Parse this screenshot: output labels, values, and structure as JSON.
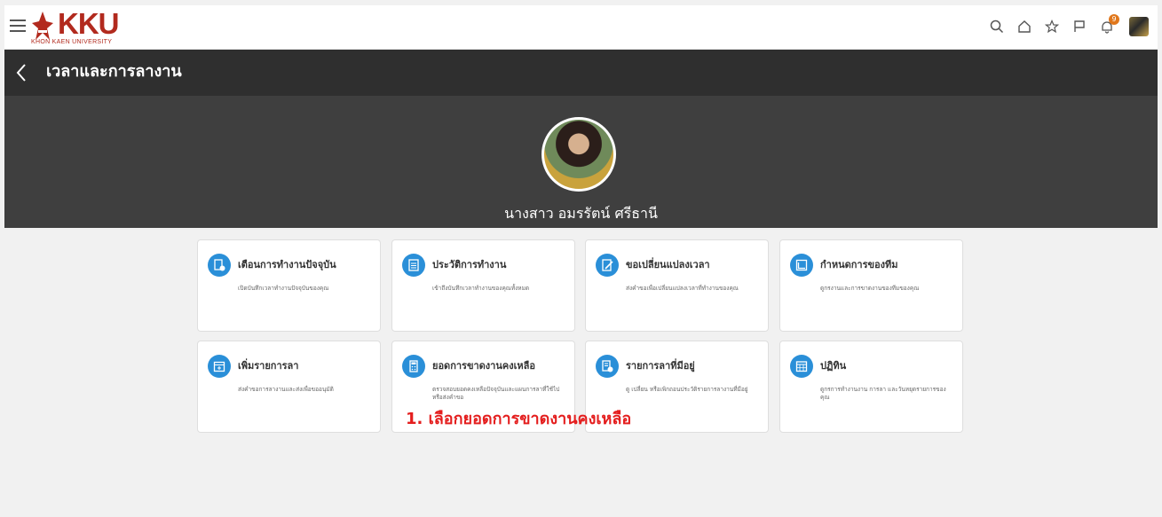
{
  "header": {
    "logo_text": "KKU",
    "logo_subtitle": "KHON KAEN UNIVERSITY",
    "notification_count": "9",
    "icons": [
      "menu-icon",
      "search-icon",
      "home-icon",
      "star-icon",
      "flag-icon",
      "bell-icon"
    ]
  },
  "titlebar": {
    "title": "เวลาและการลางาน"
  },
  "profile": {
    "name": "นางสาว อมรรัตน์ ศรีธานี"
  },
  "cards": [
    {
      "title": "เตือนการทำงานปัจจุบัน",
      "desc": "เปิดบันทึกเวลาทำงานปัจจุบันของคุณ",
      "icon": "document-clock-icon"
    },
    {
      "title": "ประวัติการทำงาน",
      "desc": "เข้าถึงบันทึกเวลาทำงานของคุณทั้งหมด",
      "icon": "document-list-icon"
    },
    {
      "title": "ขอเปลี่ยนแปลงเวลา",
      "desc": "ส่งคำขอเพื่อเปลี่ยนแปลงเวลาที่ทำงานของคุณ",
      "icon": "edit-document-icon"
    },
    {
      "title": "กำหนดการของทีม",
      "desc": "ดูกรงานและการขาดงานของทีมของคุณ",
      "icon": "chart-icon"
    },
    {
      "title": "เพิ่มรายการลา",
      "desc": "ส่งคำขอการลางานและส่งเพื่อขออนุมัติ",
      "icon": "calendar-add-icon"
    },
    {
      "title": "ยอดการขาดงานคงเหลือ",
      "desc": "ตรวจสอบยอดคงเหลือปัจจุบันและแผนการลาที่ใช้ไปหรือส่งคำขอ",
      "icon": "calculator-icon"
    },
    {
      "title": "รายการลาที่มีอยู่",
      "desc": "ดู เปลี่ยน หรือเพิกถอนประวัติรายการลางานที่มีอยู่",
      "icon": "list-clock-icon"
    },
    {
      "title": "ปฏิทิน",
      "desc": "ดูกรการทำงานงาน การลา และวันหยุดรายการของคุณ",
      "icon": "calendar-icon"
    }
  ],
  "annotation": "1. เลือกยอดการขาดงานคงเหลือ",
  "colors": {
    "accent": "#2a8fd8",
    "titlebar_bg": "#2f2f2f",
    "banner_bg": "#3f3f3f",
    "annotation": "#e41e1e",
    "brand": "#b22a1e"
  }
}
